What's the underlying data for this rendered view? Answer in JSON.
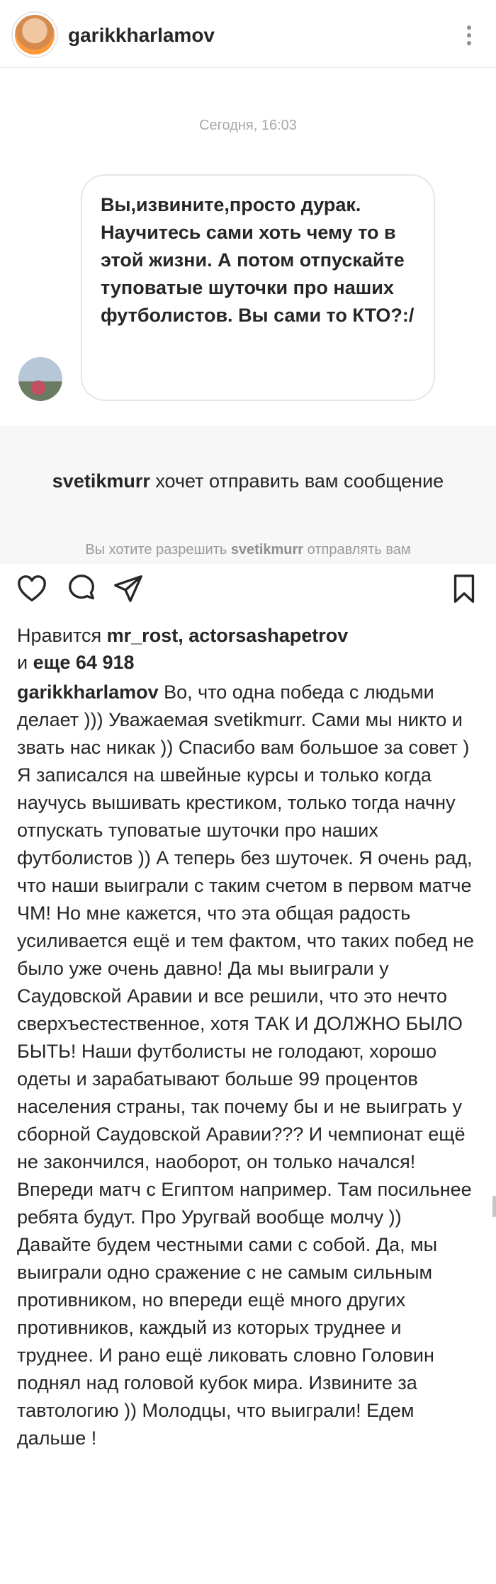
{
  "header": {
    "username": "garikkharlamov"
  },
  "chat": {
    "timestamp": "Сегодня, 16:03",
    "message": "Вы,извините,просто дурак. Научитесь сами хоть чему то в этой жизни. А потом отпускайте туповатые шуточки про наших футболистов. Вы сами то КТО?:/"
  },
  "request": {
    "sender": "svetikmurr",
    "title_rest": " хочет отправить вам сообщение",
    "sub_prefix": "Вы хотите разрешить ",
    "sub_sender": "svetikmurr",
    "sub_suffix": " отправлять вам"
  },
  "post": {
    "likes_prefix": "Нравится ",
    "likes_users": "mr_rost, actorsashapetrov",
    "likes_mid": "и ",
    "likes_more": "еще 64 918",
    "caption_author": "garikkharlamov",
    "caption_text": " Во, что одна победа с людьми делает ))) Уважаемая svetikmurr. Сами мы никто и звать нас никак )) Спасибо вам большое за совет ) Я записался на швейные курсы и только когда научусь вышивать крестиком, только тогда начну отпускать туповатые шуточки про наших футболистов )) А теперь без шуточек. Я очень рад, что наши выиграли с таким счетом в первом матче ЧМ! Но мне кажется, что эта общая радость усиливается ещё и тем фактом, что таких побед не было уже очень давно! Да мы выиграли у Саудовской Аравии и все решили, что это нечто сверхъестественное, хотя ТАК И ДОЛЖНО БЫЛО БЫТЬ! Наши футболисты не голодают, хорошо одеты и зарабатывают больше 99 процентов населения страны, так почему бы и не выиграть у сборной Саудовской Аравии??? И чемпионат ещё не закончился, наоборот, он только начался! Впереди матч с Египтом например. Там посильнее ребята будут. Про Уругвай вообще молчу )) Давайте будем честными сами с собой. Да, мы выиграли одно сражение с не самым сильным противником, но впереди ещё много других противников, каждый из которых труднее и труднее. И рано ещё ликовать словно Головин поднял над головой кубок мира. Извините за тавтологию )) Молодцы, что выиграли! Едем дальше !"
  },
  "icons": [
    "heart-icon",
    "comment-icon",
    "share-icon",
    "bookmark-icon",
    "more-icon"
  ]
}
